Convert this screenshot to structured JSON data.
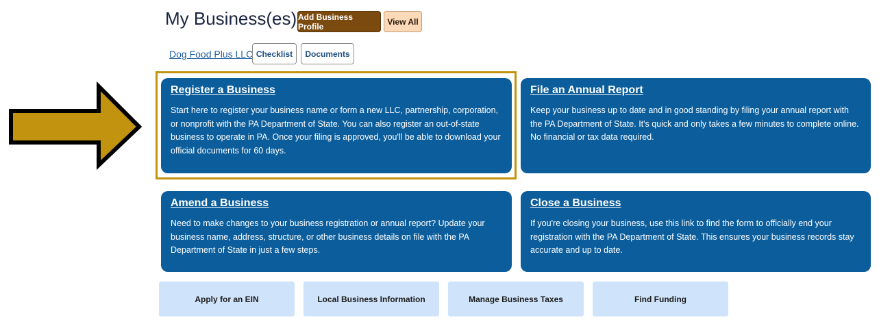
{
  "header": {
    "title": "My Business(es)",
    "add_profile_label": "Add Business Profile",
    "view_all_label": "View All"
  },
  "business": {
    "name": "Dog Food Plus LLC",
    "checklist_label": "Checklist",
    "documents_label": "Documents"
  },
  "cards": [
    {
      "title": "Register a Business",
      "body": "Start here to register your business name or form a new LLC, partnership, corporation, or nonprofit with the PA Department of State. You can also register an out-of-state business to operate in PA. Once your filing is approved, you'll be able to download your official documents for 60 days."
    },
    {
      "title": "File an Annual Report",
      "body": "Keep your business up to date and in good standing by filing your annual report with the PA Department of State. It's quick and only takes a few minutes to complete online. No financial or tax data required."
    },
    {
      "title": "Amend a Business",
      "body": "Need to make changes to your business registration or annual report? Update your business name, address, structure, or other business details on file with the PA Department of State in just a few steps."
    },
    {
      "title": "Close a Business",
      "body": "If you're closing your business, use this link to find the form to officially end your registration with the PA Department of State. This ensures your business records stay accurate and up to date."
    }
  ],
  "quick_links": [
    {
      "label": "Apply for an EIN"
    },
    {
      "label": "Local Business Information"
    },
    {
      "label": "Manage Business Taxes"
    },
    {
      "label": "Find Funding"
    }
  ],
  "colors": {
    "card_blue": "#0b5d9b",
    "arrow_gold": "#c1930e",
    "tile_blue": "#cfe3fa",
    "brown_button": "#7a4a0e"
  },
  "annotation": {
    "arrow_icon": "right-arrow-icon"
  }
}
